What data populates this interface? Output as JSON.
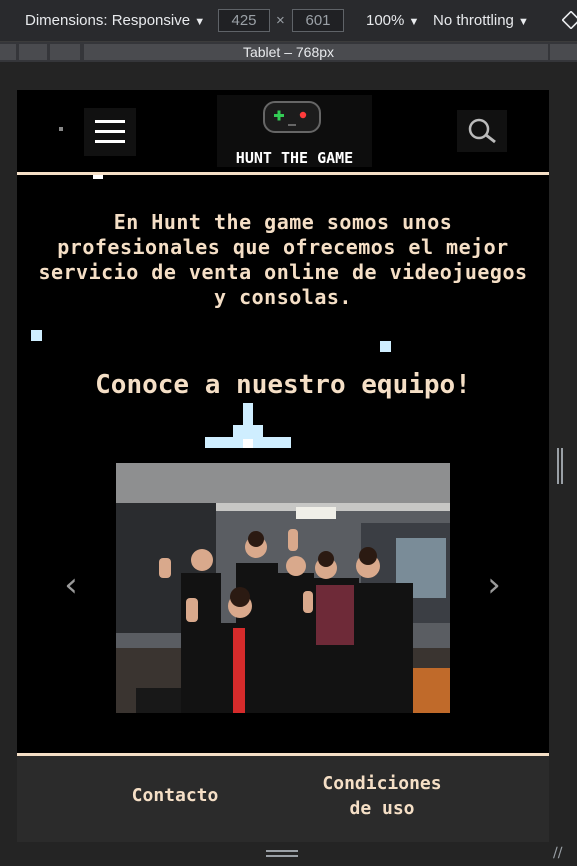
{
  "devtools": {
    "dimensions_label": "Dimensions: Responsive",
    "width": "425",
    "times": "×",
    "height": "601",
    "zoom": "100%",
    "throttling": "No throttling",
    "breakpoint_label": "Tablet – 768px"
  },
  "site": {
    "logo_text": "HUNT THE GAME",
    "headline": "En Hunt the game somos unos profesionales que ofrecemos el mejor servicio de venta online de videojuegos y consolas.",
    "team_heading": "Conoce a nuestro equipo!",
    "carousel": {
      "prev": "‹",
      "next": "›"
    },
    "footer": {
      "contact": "Contacto",
      "terms": "Condiciones de uso"
    }
  },
  "icons": [
    "menu-icon",
    "gamepad-icon",
    "search-icon",
    "caret-down-icon",
    "resize-handle-icon"
  ],
  "colors": {
    "accent_text": "#f5dfc6",
    "pixel": "#cfeeff",
    "background": "#000000"
  }
}
